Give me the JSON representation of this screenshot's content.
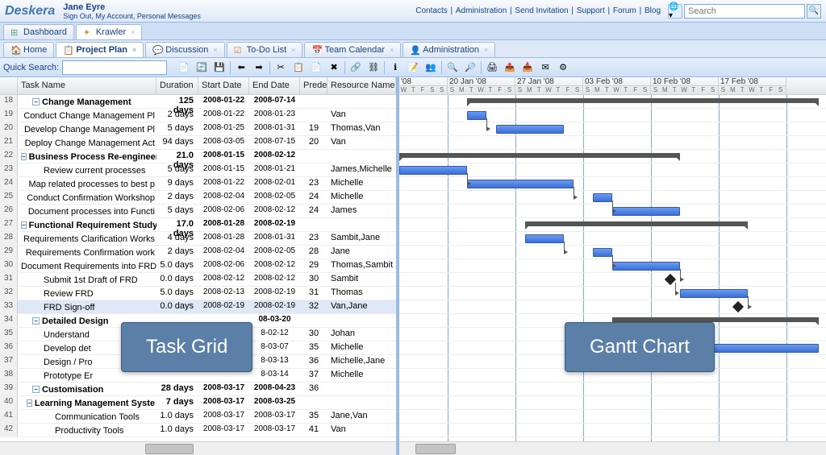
{
  "app": {
    "name": "Deskera"
  },
  "user": {
    "name": "Jane Eyre",
    "links": [
      "Sign Out",
      "My Account",
      "Personal Messages"
    ]
  },
  "topnav": [
    "Contacts",
    "Administration",
    "Send Invitation",
    "Support",
    "Forum",
    "Blog"
  ],
  "search": {
    "placeholder": "Search"
  },
  "main_tabs": [
    {
      "label": "Dashboard",
      "active": false,
      "closable": false
    },
    {
      "label": "Krawler",
      "active": true,
      "closable": true
    }
  ],
  "sub_tabs": [
    {
      "label": "Home",
      "closable": false
    },
    {
      "label": "Project Plan",
      "closable": true,
      "active": true
    },
    {
      "label": "Discussion",
      "closable": true
    },
    {
      "label": "To-Do List",
      "closable": true
    },
    {
      "label": "Team Calendar",
      "closable": true
    },
    {
      "label": "Administration",
      "closable": true
    }
  ],
  "toolbar": {
    "quick_search_label": "Quick Search:"
  },
  "grid": {
    "headers": {
      "num": "",
      "task": "Task Name",
      "dur": "Duration",
      "start": "Start Date",
      "end": "End Date",
      "pred": "Predec",
      "res": "Resource Names"
    },
    "rows": [
      {
        "n": 18,
        "task": "Change Management",
        "dur": "125 days",
        "start": "2008-01-22",
        "end": "2008-07-14",
        "pred": "",
        "res": "",
        "summary": true,
        "indent": 1
      },
      {
        "n": 19,
        "task": "Conduct Change Management Pl",
        "dur": "2 days",
        "start": "2008-01-22",
        "end": "2008-01-23",
        "pred": "",
        "res": "Van",
        "indent": 2
      },
      {
        "n": 20,
        "task": "Develop Change Management Pl",
        "dur": "5 days",
        "start": "2008-01-25",
        "end": "2008-01-31",
        "pred": "19",
        "res": "Thomas,Van",
        "indent": 2
      },
      {
        "n": 21,
        "task": "Deploy Change Management Act",
        "dur": "94 days",
        "start": "2008-03-05",
        "end": "2008-07-15",
        "pred": "20",
        "res": "Van",
        "indent": 2
      },
      {
        "n": 22,
        "task": "Business Process Re-engineerin",
        "dur": "21.0 days",
        "start": "2008-01-15",
        "end": "2008-02-12",
        "pred": "",
        "res": "",
        "summary": true,
        "indent": 1
      },
      {
        "n": 23,
        "task": "Review current processes",
        "dur": "5 days",
        "start": "2008-01-15",
        "end": "2008-01-21",
        "pred": "",
        "res": "James,Michelle",
        "indent": 2
      },
      {
        "n": 24,
        "task": "Map related processes to best p",
        "dur": "9 days",
        "start": "2008-01-22",
        "end": "2008-02-01",
        "pred": "23",
        "res": "Michelle",
        "indent": 2
      },
      {
        "n": 25,
        "task": "Conduct Confirmation Workshop",
        "dur": "2 days",
        "start": "2008-02-04",
        "end": "2008-02-05",
        "pred": "24",
        "res": "Michelle",
        "indent": 2
      },
      {
        "n": 26,
        "task": "Document processes into Functi",
        "dur": "5 days",
        "start": "2008-02-06",
        "end": "2008-02-12",
        "pred": "24",
        "res": "James",
        "indent": 2
      },
      {
        "n": 27,
        "task": "Functional Requirement Study",
        "dur": "17.0 days",
        "start": "2008-01-28",
        "end": "2008-02-19",
        "pred": "",
        "res": "",
        "summary": true,
        "indent": 1
      },
      {
        "n": 28,
        "task": "Requirements Clarification Works",
        "dur": "4 days",
        "start": "2008-01-28",
        "end": "2008-01-31",
        "pred": "23",
        "res": "Sambit,Jane",
        "indent": 2
      },
      {
        "n": 29,
        "task": "Requirements Confirmation work",
        "dur": "2 days",
        "start": "2008-02-04",
        "end": "2008-02-05",
        "pred": "28",
        "res": "Jane",
        "indent": 2
      },
      {
        "n": 30,
        "task": "Document Requirements into FRD",
        "dur": "5.0 days",
        "start": "2008-02-06",
        "end": "2008-02-12",
        "pred": "29",
        "res": "Thomas,Sambit",
        "indent": 2
      },
      {
        "n": 31,
        "task": "Submit 1st Draft of FRD",
        "dur": "0.0 days",
        "start": "2008-02-12",
        "end": "2008-02-12",
        "pred": "30",
        "res": "Sambit",
        "indent": 2
      },
      {
        "n": 32,
        "task": "Review FRD",
        "dur": "5.0 days",
        "start": "2008-02-13",
        "end": "2008-02-19",
        "pred": "31",
        "res": "Thomas",
        "indent": 2
      },
      {
        "n": 33,
        "task": "FRD Sign-off",
        "dur": "0.0 days",
        "start": "2008-02-19",
        "end": "2008-02-19",
        "pred": "32",
        "res": "Van,Jane",
        "indent": 2,
        "selected": true
      },
      {
        "n": 34,
        "task": "Detailed Design",
        "dur": "",
        "start": "",
        "end": "08-03-20",
        "pred": "",
        "res": "",
        "summary": true,
        "indent": 1
      },
      {
        "n": 35,
        "task": "Understand",
        "dur": "",
        "start": "",
        "end": "8-02-12",
        "pred": "30",
        "res": "Johan",
        "indent": 2
      },
      {
        "n": 36,
        "task": "Develop det",
        "dur": "",
        "start": "",
        "end": "8-03-07",
        "pred": "35",
        "res": "Michelle",
        "indent": 2
      },
      {
        "n": 37,
        "task": "Design / Pro",
        "dur": "",
        "start": "",
        "end": "8-03-13",
        "pred": "36",
        "res": "Michelle,Jane",
        "indent": 2
      },
      {
        "n": 38,
        "task": "Prototype Er",
        "dur": "",
        "start": "",
        "end": "8-03-14",
        "pred": "37",
        "res": "Michelle",
        "indent": 2
      },
      {
        "n": 39,
        "task": "Customisation",
        "dur": "28 days",
        "start": "2008-03-17",
        "end": "2008-04-23",
        "pred": "36",
        "res": "",
        "summary": true,
        "indent": 1
      },
      {
        "n": 40,
        "task": "Learning Management Syste",
        "dur": "7 days",
        "start": "2008-03-17",
        "end": "2008-03-25",
        "pred": "",
        "res": "",
        "summary": true,
        "indent": 2
      },
      {
        "n": 41,
        "task": "Communication Tools",
        "dur": "1.0 days",
        "start": "2008-03-17",
        "end": "2008-03-17",
        "pred": "35",
        "res": "Jane,Van",
        "indent": 3
      },
      {
        "n": 42,
        "task": "Productivity Tools",
        "dur": "1.0 days",
        "start": "2008-03-17",
        "end": "2008-03-17",
        "pred": "41",
        "res": "Van",
        "indent": 3
      }
    ]
  },
  "gantt": {
    "weeks": [
      {
        "label": "'08",
        "short": true
      },
      {
        "label": "20 Jan '08"
      },
      {
        "label": "27 Jan '08"
      },
      {
        "label": "03 Feb '08"
      },
      {
        "label": "10 Feb '08"
      },
      {
        "label": "17 Feb '08"
      }
    ],
    "day_letters": [
      "S",
      "M",
      "T",
      "W",
      "T",
      "F",
      "S"
    ]
  },
  "callouts": {
    "task_grid": "Task Grid",
    "gantt_chart": "Gantt Chart"
  }
}
